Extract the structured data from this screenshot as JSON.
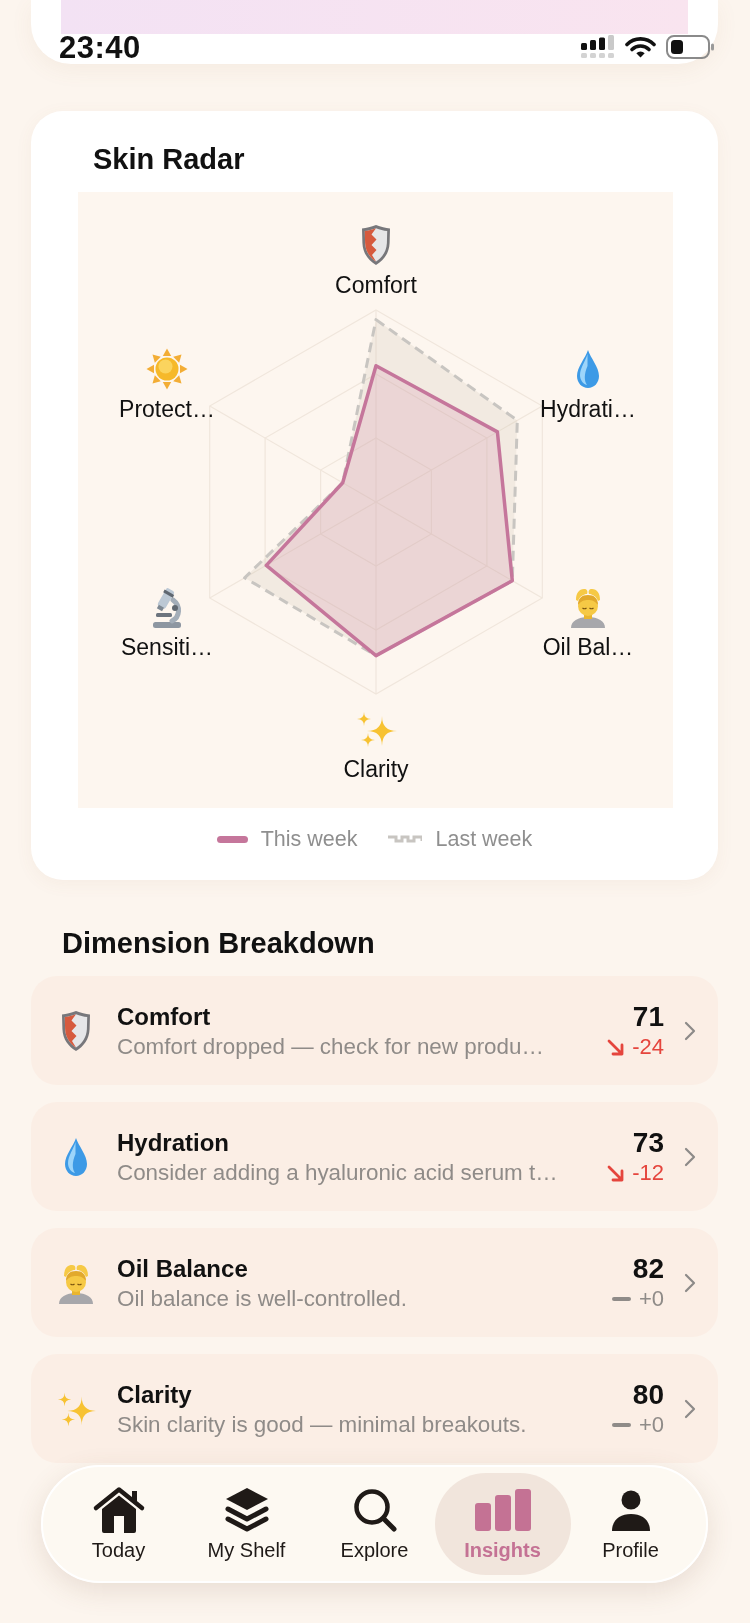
{
  "status_bar": {
    "time": "23:40"
  },
  "radar": {
    "title": "Skin Radar",
    "axes": [
      {
        "label": "Comfort"
      },
      {
        "label": "Hydrati…"
      },
      {
        "label": "Oil Bal…"
      },
      {
        "label": "Clarity"
      },
      {
        "label": "Sensiti…"
      },
      {
        "label": "Protect…"
      }
    ],
    "legend": [
      {
        "label": "This week",
        "kind": "solid"
      },
      {
        "label": "Last week",
        "kind": "dashed"
      }
    ]
  },
  "breakdown": {
    "title": "Dimension Breakdown",
    "rows": [
      {
        "name": "Comfort",
        "note": "Comfort dropped — check for new produ…",
        "score": "71",
        "kind": "down",
        "change": "-24"
      },
      {
        "name": "Hydration",
        "note": "Consider adding a hyaluronic acid serum t…",
        "score": "73",
        "kind": "down",
        "change": "-12"
      },
      {
        "name": "Oil Balance",
        "note": "Oil balance is well-controlled.",
        "score": "82",
        "kind": "flat",
        "change": "+0"
      },
      {
        "name": "Clarity",
        "note": "Skin clarity is good — minimal breakouts.",
        "score": "80",
        "kind": "flat",
        "change": "+0"
      }
    ]
  },
  "tab_bar": {
    "tabs": [
      {
        "label": "Today",
        "selected": false
      },
      {
        "label": "My Shelf",
        "selected": false
      },
      {
        "label": "Explore",
        "selected": false
      },
      {
        "label": "Insights",
        "selected": true
      },
      {
        "label": "Profile",
        "selected": false
      }
    ]
  }
}
